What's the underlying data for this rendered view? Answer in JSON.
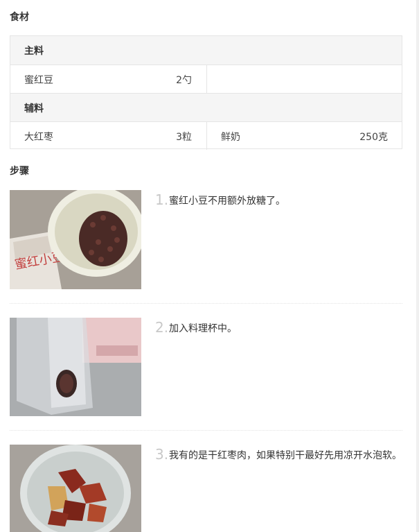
{
  "ingredients": {
    "title": "食材",
    "main": {
      "label": "主料",
      "items": [
        {
          "name": "蜜红豆",
          "amount": "2勺"
        }
      ]
    },
    "aux": {
      "label": "辅料",
      "items": [
        {
          "name": "大红枣",
          "amount": "3粒"
        },
        {
          "name": "鲜奶",
          "amount": "250克"
        }
      ]
    }
  },
  "steps": {
    "title": "步骤",
    "list": [
      {
        "number": "1.",
        "text": "蜜红小豆不用额外放糖了。",
        "image": "red-bean-bowl-photo",
        "package_text": "蜜红小豆"
      },
      {
        "number": "2.",
        "text": "加入料理杯中。",
        "image": "blender-cup-photo"
      },
      {
        "number": "3.",
        "text": "我有的是干红枣肉，如果特别干最好先用凉开水泡软。",
        "image": "red-dates-bowl-photo"
      }
    ]
  }
}
